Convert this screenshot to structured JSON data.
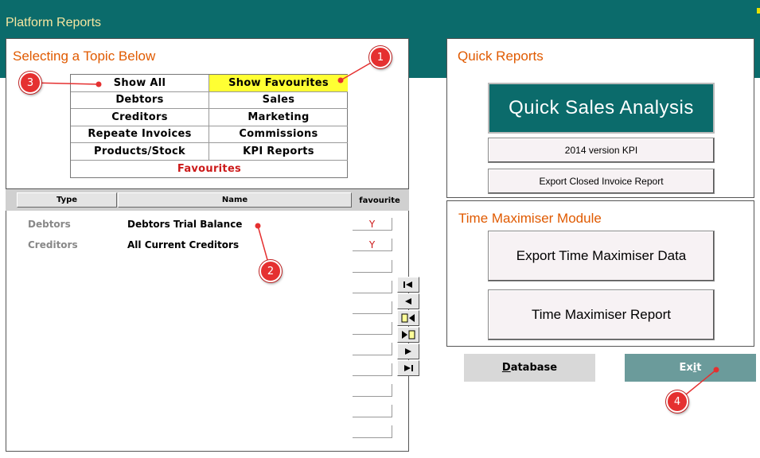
{
  "header": {
    "title": "Platform Reports"
  },
  "topics": {
    "title": "Selecting a Topic Below",
    "rows": [
      [
        "Show All",
        "Show Favourites"
      ],
      [
        "Debtors",
        "Sales"
      ],
      [
        "Creditors",
        "Marketing"
      ],
      [
        "Repeate Invoices",
        "Commissions"
      ],
      [
        "Products/Stock",
        "KPI Reports"
      ]
    ],
    "favourites_label": "Favourites",
    "highlighted": "Show Favourites",
    "highlight_color": "#ffff33"
  },
  "report_list": {
    "columns": {
      "type": "Type",
      "name": "Name",
      "favourite": "favourite"
    },
    "records": [
      {
        "type": "Debtors",
        "name": "Debtors Trial Balance",
        "favourite": "Y"
      },
      {
        "type": "Creditors",
        "name": "All Current Creditors",
        "favourite": "Y"
      }
    ],
    "empty_favourite_rows": 10
  },
  "navigation": {
    "buttons": [
      "first-record-icon",
      "previous-record-icon",
      "new-record-before-icon",
      "new-record-after-icon",
      "next-record-icon",
      "last-record-icon"
    ]
  },
  "quick_reports": {
    "title": "Quick Reports",
    "main_button": "Quick Sales Analysis",
    "kpi_button": "2014 version KPI",
    "export_closed_button": "Export Closed Invoice Report"
  },
  "time_maximiser": {
    "title": "Time Maximiser Module",
    "export_button": "Export Time Maximiser Data",
    "report_button": "Time Maximiser Report"
  },
  "footer": {
    "database_first": "D",
    "database_rest": "atabase",
    "exit_first": "Ex",
    "exit_underline": "i",
    "exit_rest": "t"
  },
  "callouts": [
    "1",
    "2",
    "3",
    "4"
  ],
  "colors": {
    "header_teal": "#0b6b6b",
    "title_orange": "#e05a00",
    "callout_red": "#e53030",
    "exit_teal": "#6b9b9b"
  }
}
